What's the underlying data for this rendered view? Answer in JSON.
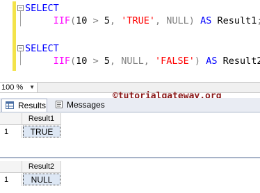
{
  "editor": {
    "query1": {
      "kw_select": "SELECT",
      "fn": "IIF",
      "open_paren": "(",
      "num_a": "10",
      "op": " > ",
      "num_b": "5",
      "sep1": ", ",
      "arg_true": "'TRUE'",
      "sep2": ", ",
      "arg_null": "NULL",
      "close_paren": ")",
      "kw_as": "AS",
      "alias": "Result1",
      "semicolon": ";"
    },
    "query2": {
      "kw_select": "SELECT",
      "fn": "IIF",
      "open_paren": "(",
      "num_a": "10",
      "op": " > ",
      "num_b": "5",
      "sep1": ", ",
      "arg_null": "NULL",
      "sep2": ", ",
      "arg_false": "'FALSE'",
      "close_paren": ")",
      "kw_as": "AS",
      "alias": "Result2",
      "semicolon": ";"
    },
    "fold_glyph": "−"
  },
  "zoom": {
    "value": "100 %",
    "arrow": "▼"
  },
  "watermark": "©tutorialgateway.org",
  "tabs": [
    {
      "label": "Results",
      "icon": "grid-icon",
      "active": true
    },
    {
      "label": "Messages",
      "icon": "messages-icon",
      "active": false
    }
  ],
  "results": [
    {
      "column": "Result1",
      "rows": [
        {
          "num": "1",
          "value": "TRUE"
        }
      ]
    },
    {
      "column": "Result2",
      "rows": [
        {
          "num": "1",
          "value": "NULL"
        }
      ]
    }
  ],
  "colors": {
    "keyword": "#0000ff",
    "function": "#ff00ff",
    "string": "#ff0000",
    "operator": "#808080",
    "watermark": "#8b1a1a",
    "selected_cell": "#dde7f4"
  }
}
